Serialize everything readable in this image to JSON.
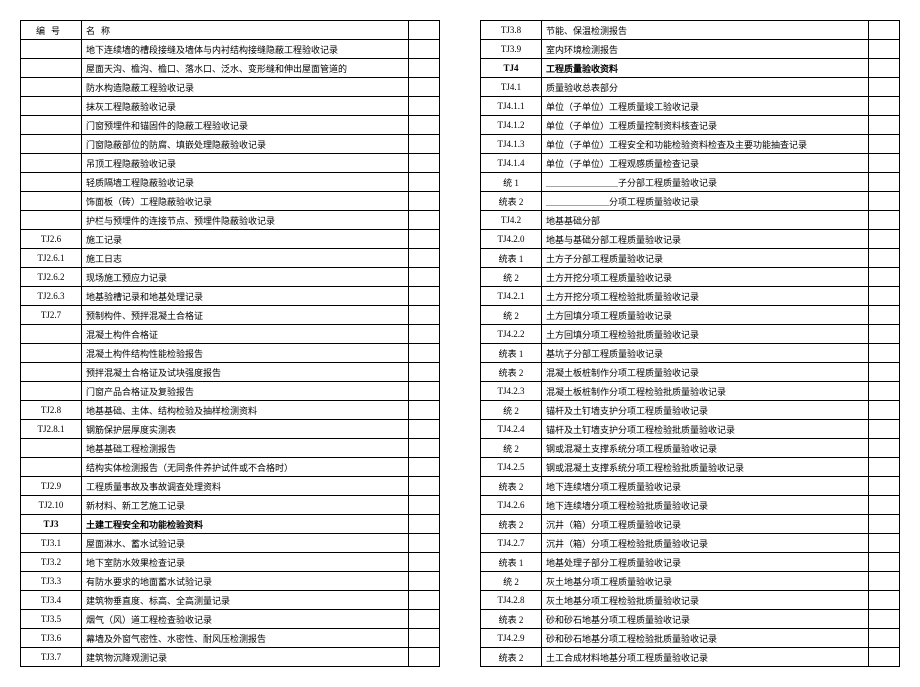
{
  "header": {
    "num": "编号",
    "name": "名称"
  },
  "left": [
    {
      "num": "",
      "name": "地下连续墙的槽段接缝及墙体与内衬结构接缝隐蔽工程验收记录"
    },
    {
      "num": "",
      "name": "屋面天沟、檐沟、檐口、落水口、泛水、变形缝和伸出屋面管道的"
    },
    {
      "num": "",
      "name": "防水构造隐蔽工程验收记录"
    },
    {
      "num": "",
      "name": "抹灰工程隐蔽验收记录"
    },
    {
      "num": "",
      "name": "门窗预埋件和锚固件的隐蔽工程验收记录"
    },
    {
      "num": "",
      "name": "门窗隐蔽部位的防腐、填嵌处理隐蔽验收记录"
    },
    {
      "num": "",
      "name": "吊顶工程隐蔽验收记录"
    },
    {
      "num": "",
      "name": "轻质隔墙工程隐蔽验收记录"
    },
    {
      "num": "",
      "name": "饰面板（砖）工程隐蔽验收记录"
    },
    {
      "num": "",
      "name": "护栏与预埋件的连接节点、预埋件隐蔽验收记录"
    },
    {
      "num": "TJ2.6",
      "name": "施工记录"
    },
    {
      "num": "TJ2.6.1",
      "name": "施工日志"
    },
    {
      "num": "TJ2.6.2",
      "name": "现场施工预应力记录"
    },
    {
      "num": "TJ2.6.3",
      "name": "地基验槽记录和地基处理记录"
    },
    {
      "num": "TJ2.7",
      "name": "预制构件、预拌混凝土合格证"
    },
    {
      "num": "",
      "name": "混凝土构件合格证"
    },
    {
      "num": "",
      "name": "混凝土构件结构性能检验报告"
    },
    {
      "num": "",
      "name": "预拌混凝土合格证及试块强度报告"
    },
    {
      "num": "",
      "name": "门窗产品合格证及复验报告"
    },
    {
      "num": "TJ2.8",
      "name": "地基基础、主体、结构检验及抽样检测资料"
    },
    {
      "num": "TJ2.8.1",
      "name": "钢筋保护层厚度实测表"
    },
    {
      "num": "",
      "name": "地基基础工程检测报告"
    },
    {
      "num": "",
      "name": "结构实体检测报告（无同条件养护试件或不合格时）"
    },
    {
      "num": "TJ2.9",
      "name": "工程质量事故及事故调查处理资料"
    },
    {
      "num": "TJ2.10",
      "name": "新材料、新工艺施工记录"
    },
    {
      "num": "TJ3",
      "name": "土建工程安全和功能检验资料",
      "bold": true
    },
    {
      "num": "TJ3.1",
      "name": "屋面淋水、蓄水试验记录"
    },
    {
      "num": "TJ3.2",
      "name": "地下室防水效果检查记录"
    },
    {
      "num": "TJ3.3",
      "name": "有防水要求的地面蓄水试验记录"
    },
    {
      "num": "TJ3.4",
      "name": "建筑物垂直度、标高、全高测量记录"
    },
    {
      "num": "TJ3.5",
      "name": "烟气（风）道工程检查验收记录"
    },
    {
      "num": "TJ3.6",
      "name": "幕墙及外窗气密性、水密性、耐风压检测报告"
    },
    {
      "num": "TJ3.7",
      "name": "建筑物沉降观测记录"
    }
  ],
  "right": [
    {
      "num": "TJ3.8",
      "name": "节能、保温检测报告"
    },
    {
      "num": "TJ3.9",
      "name": "室内环境检测报告"
    },
    {
      "num": "TJ4",
      "name": "工程质量验收资料",
      "bold": true
    },
    {
      "num": "TJ4.1",
      "name": "质量验收总表部分"
    },
    {
      "num": "TJ4.1.1",
      "name": "单位（子单位）工程质量竣工验收记录"
    },
    {
      "num": "TJ4.1.2",
      "name": "单位（子单位）工程质量控制资料核查记录"
    },
    {
      "num": "TJ4.1.3",
      "name": "单位（子单位）工程安全和功能检验资料检查及主要功能抽查记录"
    },
    {
      "num": "TJ4.1.4",
      "name": "单位（子单位）工程观感质量检查记录"
    },
    {
      "num": "统 1",
      "name": "＿＿＿＿＿＿＿＿子分部工程质量验收记录"
    },
    {
      "num": "统表 2",
      "name": "＿＿＿＿＿＿＿分项工程质量验收记录"
    },
    {
      "num": "TJ4.2",
      "name": "地基基础分部"
    },
    {
      "num": "TJ4.2.0",
      "name": "地基与基础分部工程质量验收记录"
    },
    {
      "num": "统表 1",
      "name": "土方子分部工程质量验收记录"
    },
    {
      "num": "统 2",
      "name": "土方开挖分项工程质量验收记录"
    },
    {
      "num": "TJ4.2.1",
      "name": "土方开挖分项工程检验批质量验收记录"
    },
    {
      "num": "统 2",
      "name": "土方回填分项工程质量验收记录"
    },
    {
      "num": "TJ4.2.2",
      "name": "土方回填分项工程检验批质量验收记录"
    },
    {
      "num": "统表 1",
      "name": "基坑子分部工程质量验收记录"
    },
    {
      "num": "统表 2",
      "name": "混凝土板桩制作分项工程质量验收记录"
    },
    {
      "num": "TJ4.2.3",
      "name": "混凝土板桩制作分项工程检验批质量验收记录"
    },
    {
      "num": "统 2",
      "name": "锚杆及土钉墙支护分项工程质量验收记录"
    },
    {
      "num": "TJ4.2.4",
      "name": "锚杆及土钉墙支护分项工程检验批质量验收记录"
    },
    {
      "num": "统 2",
      "name": "钢或混凝土支撑系统分项工程质量验收记录"
    },
    {
      "num": "TJ4.2.5",
      "name": "钢或混凝土支撑系统分项工程检验批质量验收记录"
    },
    {
      "num": "统表 2",
      "name": "地下连续墙分项工程质量验收记录"
    },
    {
      "num": "TJ4.2.6",
      "name": "地下连续墙分项工程检验批质量验收记录"
    },
    {
      "num": "统表 2",
      "name": "沉井（箱）分项工程质量验收记录"
    },
    {
      "num": "TJ4.2.7",
      "name": "沉井（箱）分项工程检验批质量验收记录"
    },
    {
      "num": "统表 1",
      "name": "地基处理子部分工程质量验收记录"
    },
    {
      "num": "统 2",
      "name": "灰土地基分项工程质量验收记录"
    },
    {
      "num": "TJ4.2.8",
      "name": "灰土地基分项工程检验批质量验收记录"
    },
    {
      "num": "统表 2",
      "name": "砂和砂石地基分项工程质量验收记录"
    },
    {
      "num": "TJ4.2.9",
      "name": "砂和砂石地基分项工程检验批质量验收记录"
    },
    {
      "num": "统表 2",
      "name": "土工合成材料地基分项工程质量验收记录"
    }
  ]
}
